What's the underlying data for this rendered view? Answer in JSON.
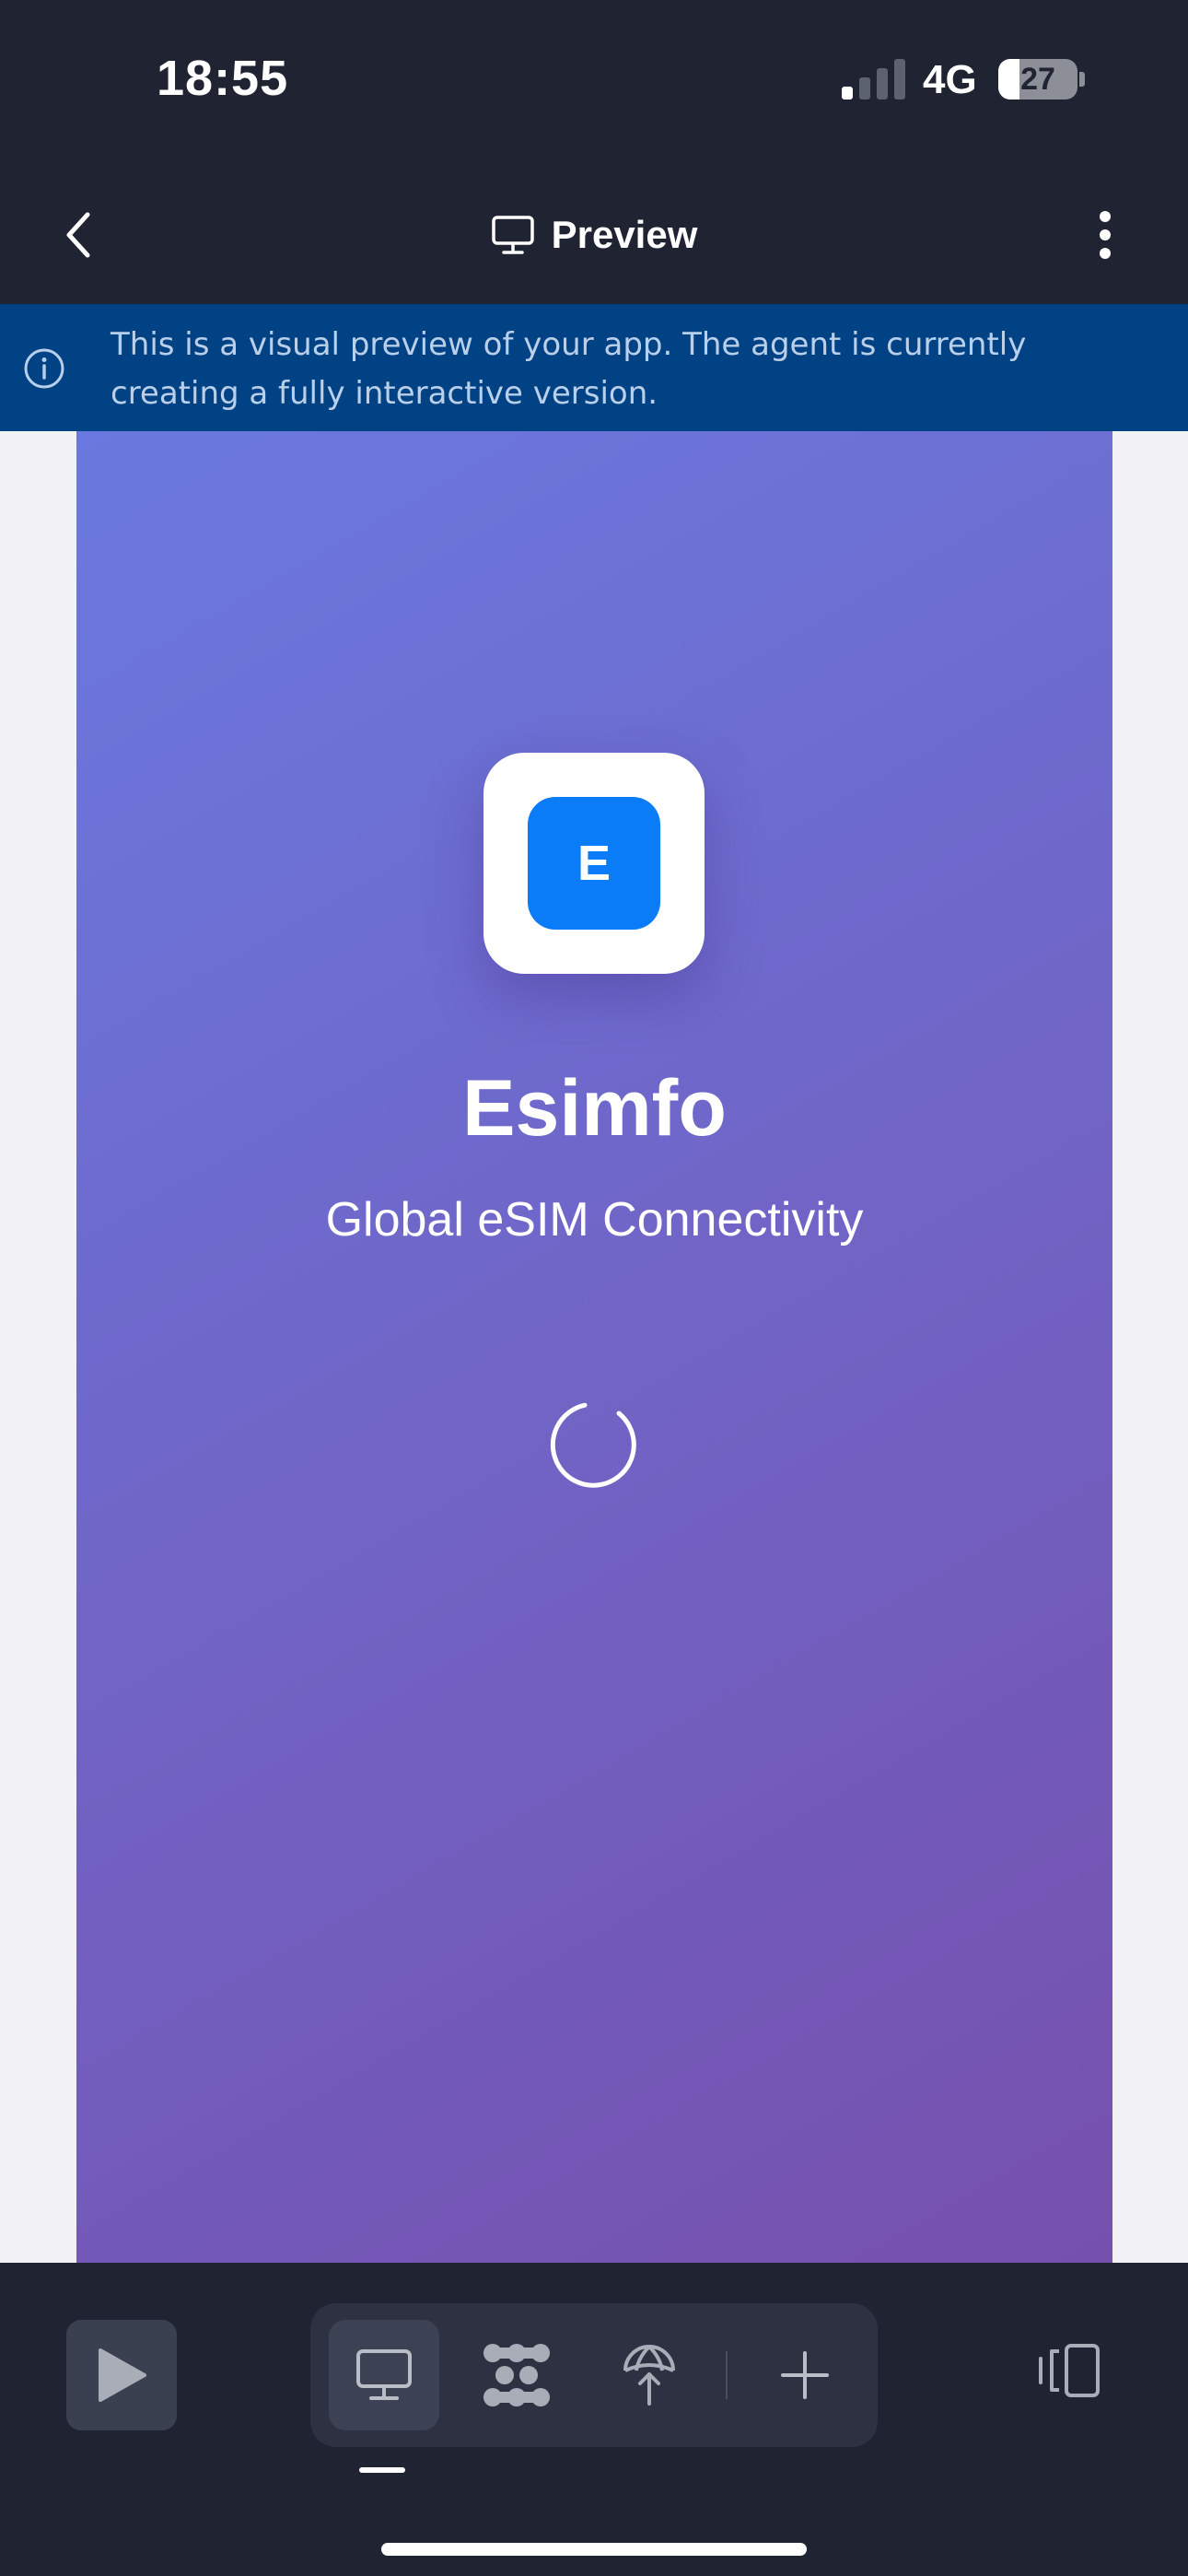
{
  "status_bar": {
    "time": "18:55",
    "network": "4G",
    "battery_level": "27"
  },
  "header": {
    "title": "Preview",
    "title_icon": "monitor-icon",
    "back_icon": "chevron-left-icon",
    "menu_icon": "more-vertical-icon"
  },
  "banner": {
    "icon": "info-icon",
    "text": "This is a visual preview of your app. The agent is currently creating a fully interactive version."
  },
  "app_preview": {
    "logo_letter": "E",
    "app_name": "Esimfo",
    "tagline": "Global eSIM Connectivity",
    "background_start": "#6a79df",
    "background_end": "#7650ad",
    "logo_color": "#0a7cf8"
  },
  "toolbar": {
    "run_icon": "play-icon",
    "tabs": [
      {
        "icon": "monitor-icon",
        "active": true
      },
      {
        "icon": "workflow-icon",
        "active": false
      },
      {
        "icon": "deploy-icon",
        "active": false
      },
      {
        "icon": "plus-icon",
        "active": false
      }
    ],
    "device_icon": "device-toggle-icon"
  },
  "colors": {
    "chrome": "#1f2332",
    "banner": "#014284",
    "banner_text": "#b9cfea"
  }
}
